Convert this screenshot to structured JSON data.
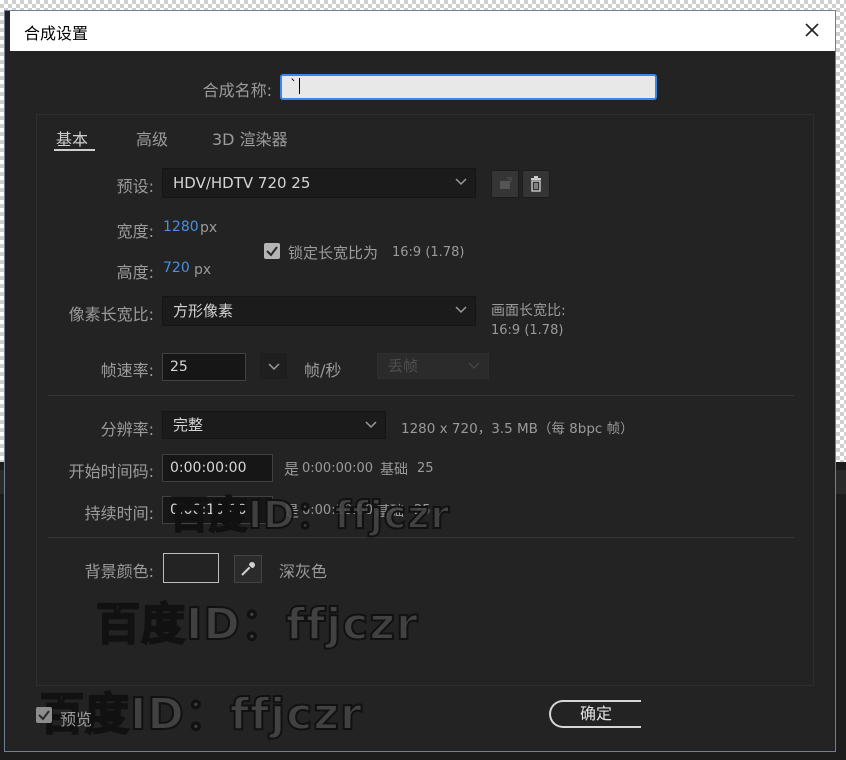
{
  "dialog": {
    "title": "合成设置",
    "close_label": "×"
  },
  "composition_name": {
    "label": "合成名称:",
    "value": "`"
  },
  "tabs": [
    {
      "label": "基本",
      "active": true
    },
    {
      "label": "高级",
      "active": false
    },
    {
      "label": "3D 渲染器",
      "active": false
    }
  ],
  "preset": {
    "label": "预设:",
    "value": "HDV/HDTV 720 25"
  },
  "width": {
    "label": "宽度:",
    "value": "1280",
    "unit": "px"
  },
  "height": {
    "label": "高度:",
    "value": "720",
    "unit": "px"
  },
  "lock_aspect": {
    "label": "锁定长宽比为",
    "ratio": "16:9 (1.78)",
    "checked": true
  },
  "pixel_aspect": {
    "label": "像素长宽比:",
    "value": "方形像素",
    "frame_aspect_label": "画面长宽比:",
    "frame_aspect_value": "16:9 (1.78)"
  },
  "frame_rate": {
    "label": "帧速率:",
    "value": "25",
    "unit": "帧/秒",
    "drop_frame": "丢帧"
  },
  "resolution": {
    "label": "分辨率:",
    "value": "完整",
    "info": "1280 x 720，3.5 MB（每 8bpc 帧）"
  },
  "start_timecode": {
    "label": "开始时间码:",
    "value": "0:00:00:00",
    "is_label": "是",
    "is_value": "0:00:00:00",
    "base_label": "基础",
    "base_value": "25"
  },
  "duration": {
    "label": "持续时间:",
    "value": "0:00:10:00",
    "is_label": "是",
    "is_value": "0:00:10:00",
    "base_label": "基础",
    "base_value": "25"
  },
  "background_color": {
    "label": "背景颜色:",
    "name": "深灰色",
    "swatch": "#232323"
  },
  "preview": {
    "label": "预览",
    "checked": true
  },
  "buttons": {
    "ok": "确定"
  },
  "watermark": "百度ID：ffjczr"
}
